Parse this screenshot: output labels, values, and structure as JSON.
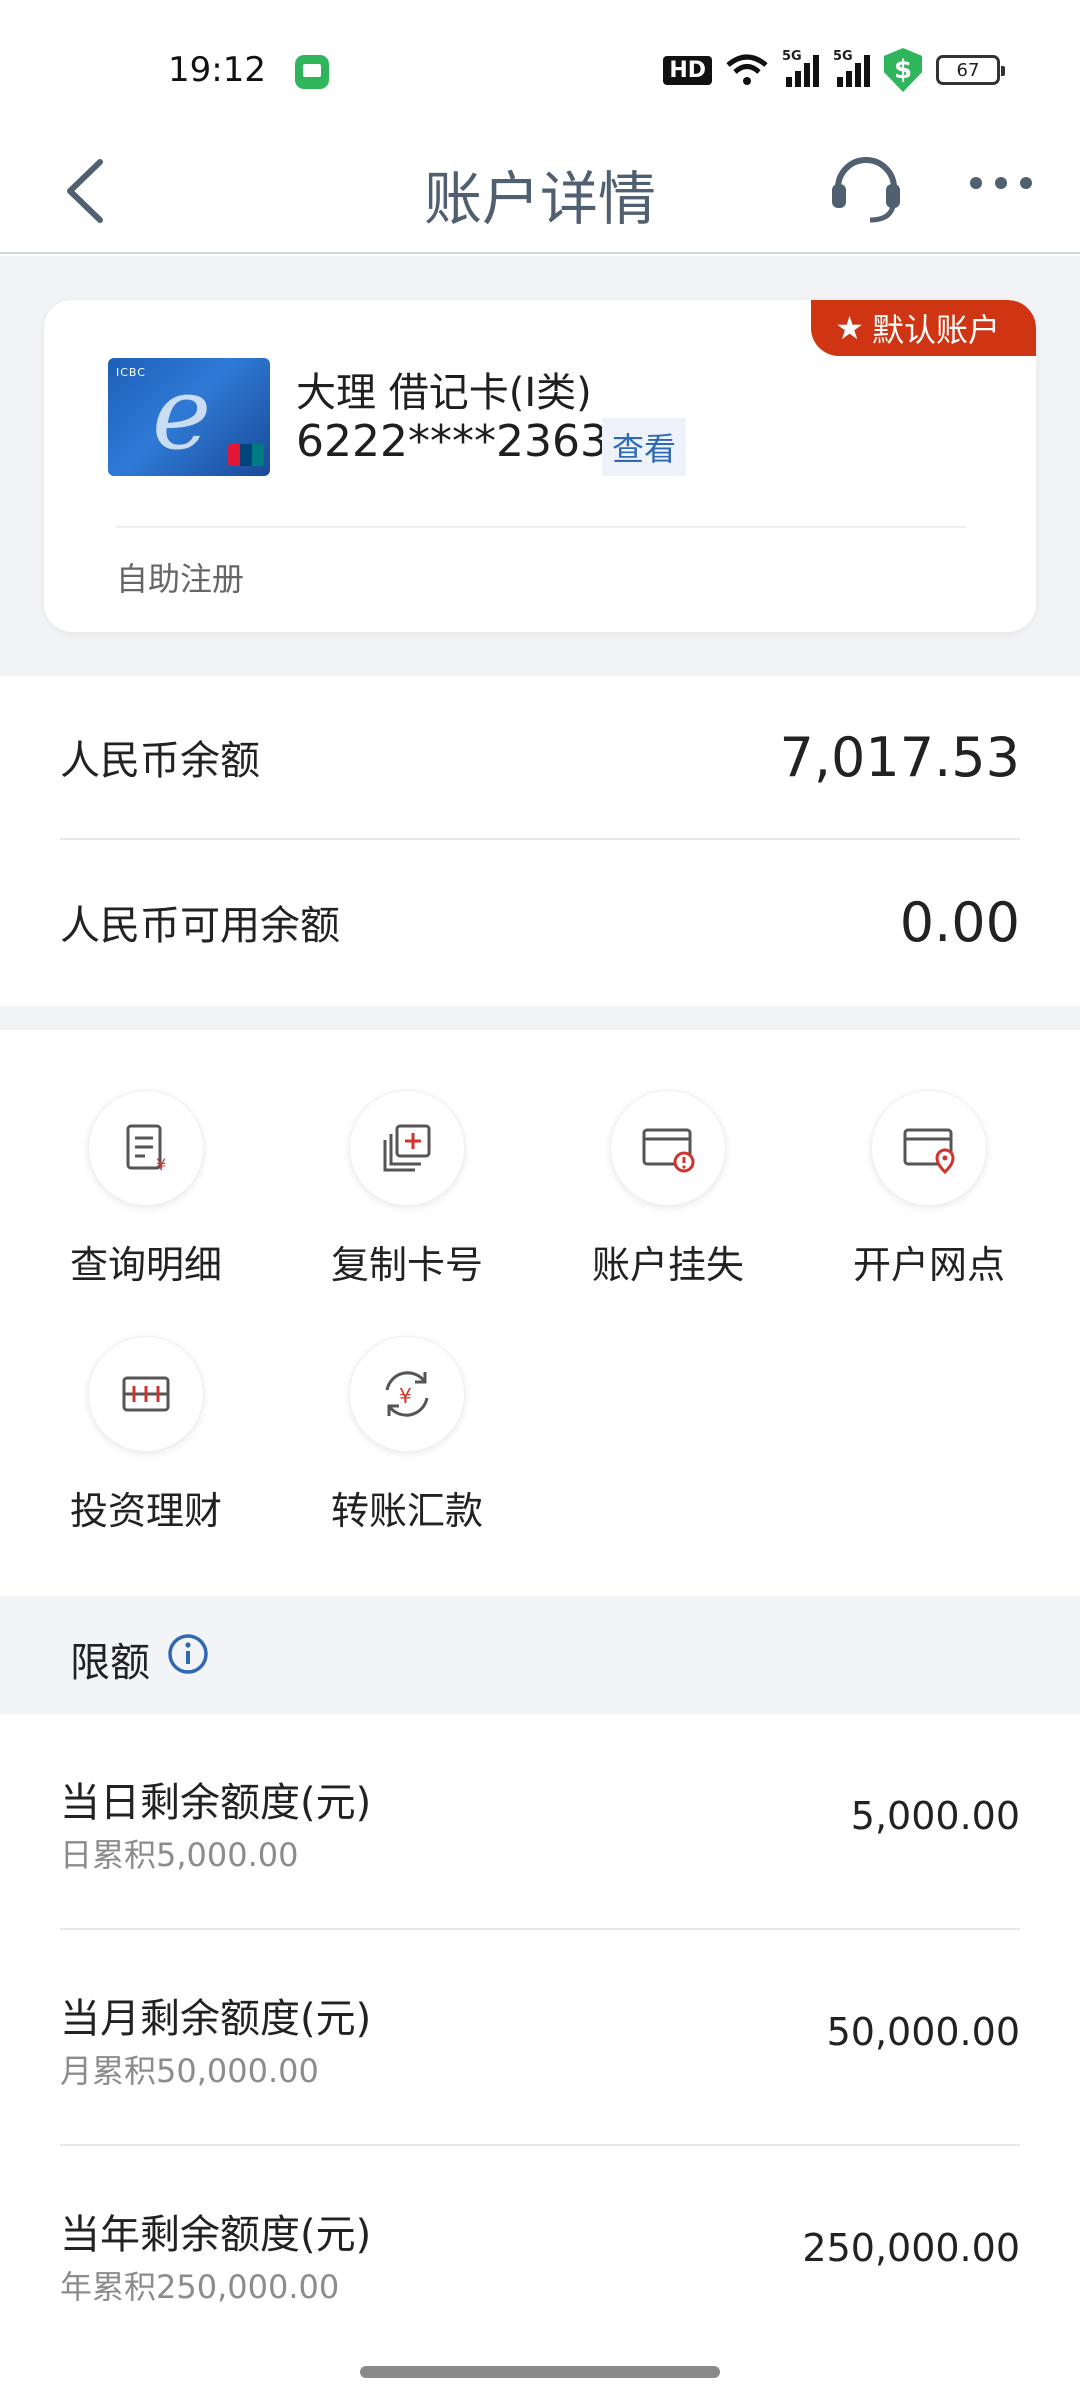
{
  "status_bar": {
    "time": "19:12",
    "hd": "HD",
    "signal1": "5G",
    "signal2": "5G",
    "shield_symbol": "$",
    "battery": "67"
  },
  "nav": {
    "title": "账户详情",
    "back_icon": "chevron-left-icon",
    "service_icon": "headset-icon",
    "more_icon": "more-icon"
  },
  "card": {
    "badge": "默认账户",
    "name": "大理 借记卡(I类)",
    "number": "6222****2363",
    "view_label": "查看",
    "register_label": "自助注册"
  },
  "balances": [
    {
      "label": "人民币余额",
      "value": "7,017.53"
    },
    {
      "label": "人民币可用余额",
      "value": "0.00"
    }
  ],
  "actions": [
    {
      "label": "查询明细",
      "icon": "statement-icon"
    },
    {
      "label": "复制卡号",
      "icon": "copy-card-icon"
    },
    {
      "label": "账户挂失",
      "icon": "report-loss-icon"
    },
    {
      "label": "开户网点",
      "icon": "branch-location-icon"
    },
    {
      "label": "投资理财",
      "icon": "investment-icon"
    },
    {
      "label": "转账汇款",
      "icon": "transfer-icon"
    }
  ],
  "limits": {
    "title": "限额",
    "rows": [
      {
        "name": "当日剩余额度(元)",
        "sub": "日累积5,000.00",
        "value": "5,000.00"
      },
      {
        "name": "当月剩余额度(元)",
        "sub": "月累积50,000.00",
        "value": "50,000.00"
      },
      {
        "name": "当年剩余额度(元)",
        "sub": "年累积250,000.00",
        "value": "250,000.00"
      }
    ]
  },
  "colors": {
    "accent_red": "#cf3513",
    "link_blue": "#2f69b3",
    "title_gray": "#506070",
    "background_gray": "#f2f3f5"
  }
}
